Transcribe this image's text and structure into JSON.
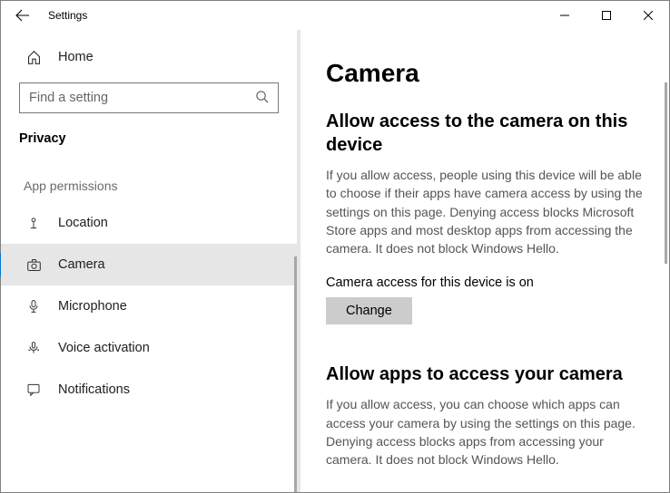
{
  "titlebar": {
    "title": "Settings"
  },
  "sidebar": {
    "home": "Home",
    "search_placeholder": "Find a setting",
    "category": "Privacy",
    "group": "App permissions",
    "items": [
      {
        "label": "Location"
      },
      {
        "label": "Camera"
      },
      {
        "label": "Microphone"
      },
      {
        "label": "Voice activation"
      },
      {
        "label": "Notifications"
      }
    ]
  },
  "content": {
    "page_title": "Camera",
    "section1": {
      "heading": "Allow access to the camera on this device",
      "body": "If you allow access, people using this device will be able to choose if their apps have camera access by using the settings on this page. Denying access blocks Microsoft Store apps and most desktop apps from accessing the camera. It does not block Windows Hello.",
      "status": "Camera access for this device is on",
      "change_btn": "Change"
    },
    "section2": {
      "heading": "Allow apps to access your camera",
      "body": "If you allow access, you can choose which apps can access your camera by using the settings on this page. Denying access blocks apps from accessing your camera. It does not block Windows Hello."
    }
  }
}
